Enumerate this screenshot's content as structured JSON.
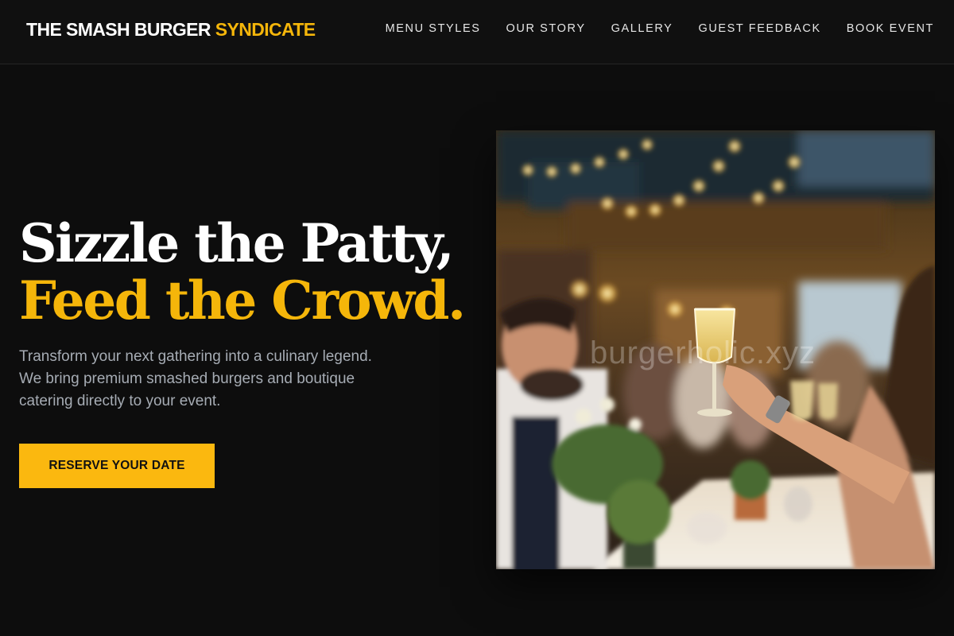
{
  "header": {
    "brand_main": "THE SMASH BURGER",
    "brand_accent": "SYNDICATE",
    "nav": [
      {
        "label": "MENU STYLES"
      },
      {
        "label": "OUR STORY"
      },
      {
        "label": "GALLERY"
      },
      {
        "label": "GUEST FEEDBACK"
      },
      {
        "label": "BOOK EVENT"
      }
    ]
  },
  "hero": {
    "title_line1": "Sizzle the Patty,",
    "title_line2": "Feed the Crowd.",
    "description": "Transform your next gathering into a culinary legend. We bring premium smashed burgers and boutique catering directly to your event.",
    "cta_label": "RESERVE YOUR DATE",
    "image": {
      "description": "Guests raising champagne glasses in a toast at a warmly lit banquet with string lights",
      "watermark": "burgerholic.xyz"
    }
  },
  "colors": {
    "accent": "#f5b60a",
    "background": "#0d0d0d",
    "button": "#fbb80f"
  }
}
